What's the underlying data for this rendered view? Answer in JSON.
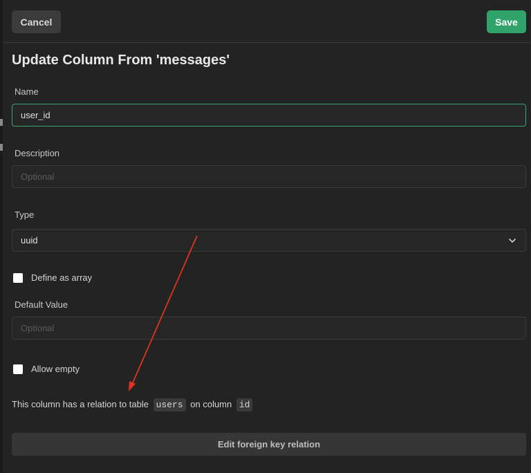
{
  "toolbar": {
    "cancel_label": "Cancel",
    "save_label": "Save"
  },
  "title": "Update Column From 'messages'",
  "fields": {
    "name": {
      "label": "Name",
      "value": "user_id"
    },
    "description": {
      "label": "Description",
      "placeholder": "Optional"
    },
    "type": {
      "label": "Type",
      "value": "uuid"
    },
    "define_array": {
      "label": "Define as array",
      "checked": false
    },
    "default_value": {
      "label": "Default Value",
      "placeholder": "Optional"
    },
    "allow_empty": {
      "label": "Allow empty",
      "checked": false
    }
  },
  "relation": {
    "prefix": "This column has a relation to table",
    "table": "users",
    "middle": "on column",
    "column": "id"
  },
  "edit_fk_label": "Edit foreign key relation",
  "colors": {
    "background": "#232323",
    "save_green": "#2fa36a",
    "focus_border": "#3ba776",
    "annotation_arrow": "#e0321e"
  },
  "icons": {
    "type_dropdown": "chevron-down-icon"
  }
}
